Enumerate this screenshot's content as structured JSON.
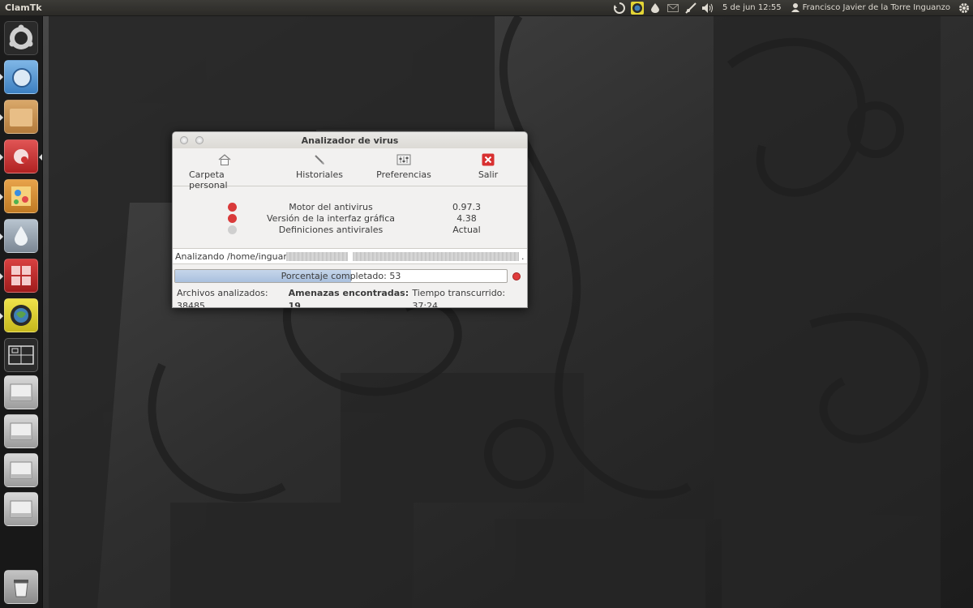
{
  "panel": {
    "app_name": "ClamTk",
    "clock": "5 de jun 12:55",
    "user": "Francisco Javier de la Torre Inguanzo"
  },
  "window": {
    "title": "Analizador de virus",
    "toolbar": {
      "home_label": "Carpeta personal",
      "history_label": "Historiales",
      "prefs_label": "Preferencias",
      "quit_label": "Salir"
    },
    "info": [
      {
        "label": "Motor del antivirus",
        "value": "0.97.3",
        "status": "error"
      },
      {
        "label": "Versión de la interfaz gráfica",
        "value": "4.38",
        "status": "error"
      },
      {
        "label": "Definiciones antivirales",
        "value": "Actual",
        "status": "ok"
      }
    ],
    "scanning_text": "Analizando /home/inguanzo",
    "scanning_suffix": ".",
    "progress": {
      "label": "Porcentaje completado: 53",
      "percent": 53
    },
    "stats": {
      "files": "Archivos analizados: 38485",
      "threats": "Amenazas encontradas: 19",
      "elapsed": "Tiempo transcurrido: 37:24"
    }
  },
  "colors": {
    "error": "#d93a3a",
    "ok": "#cfcfcf",
    "progress": "#a9c0de"
  }
}
